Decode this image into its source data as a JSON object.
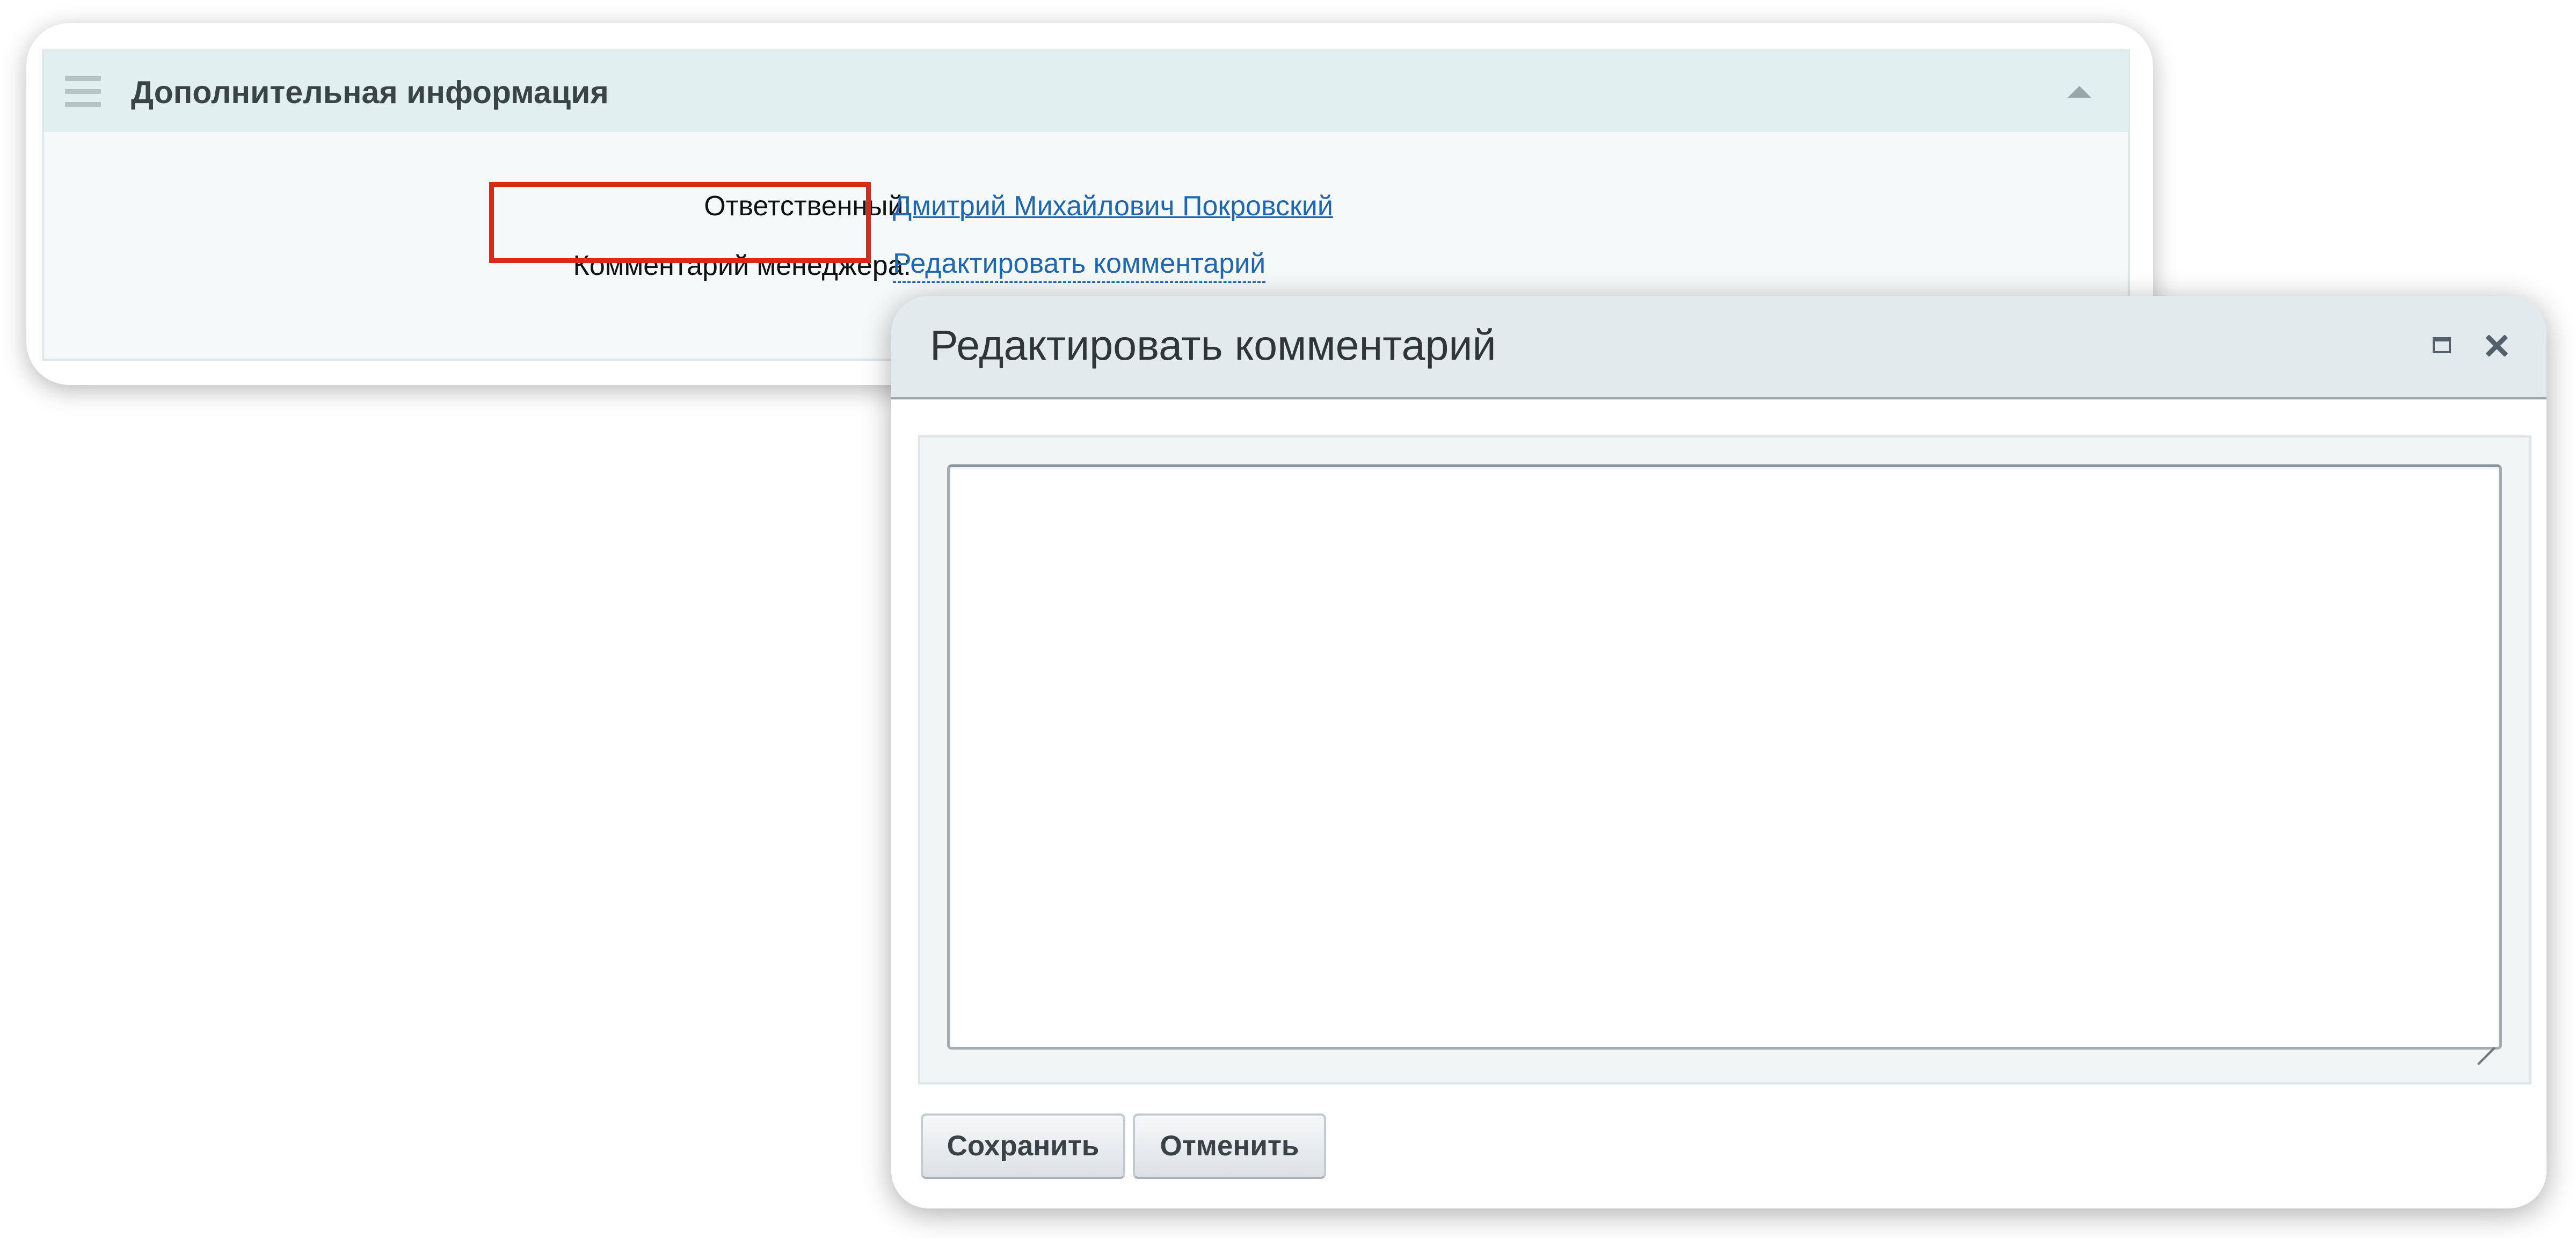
{
  "info_section": {
    "title": "Дополнительная информация",
    "fields": [
      {
        "label": "Ответственный:",
        "value": "Дмитрий Михайлович Покровский"
      },
      {
        "label": "Комментарий менеджера:",
        "value": "Редактировать комментарий"
      }
    ]
  },
  "dialog": {
    "title": "Редактировать комментарий",
    "textarea_value": "",
    "buttons": {
      "save": "Сохранить",
      "cancel": "Отменить"
    }
  },
  "colors": {
    "highlight": "#d72b1a",
    "link": "#2067b0",
    "header_bg": "#e2eff0",
    "dialog_header_bg": "#e2eaed"
  },
  "icons": [
    "drag-handle-icon",
    "collapse-arrow-icon",
    "maximize-icon",
    "close-icon",
    "resize-grip-icon"
  ]
}
